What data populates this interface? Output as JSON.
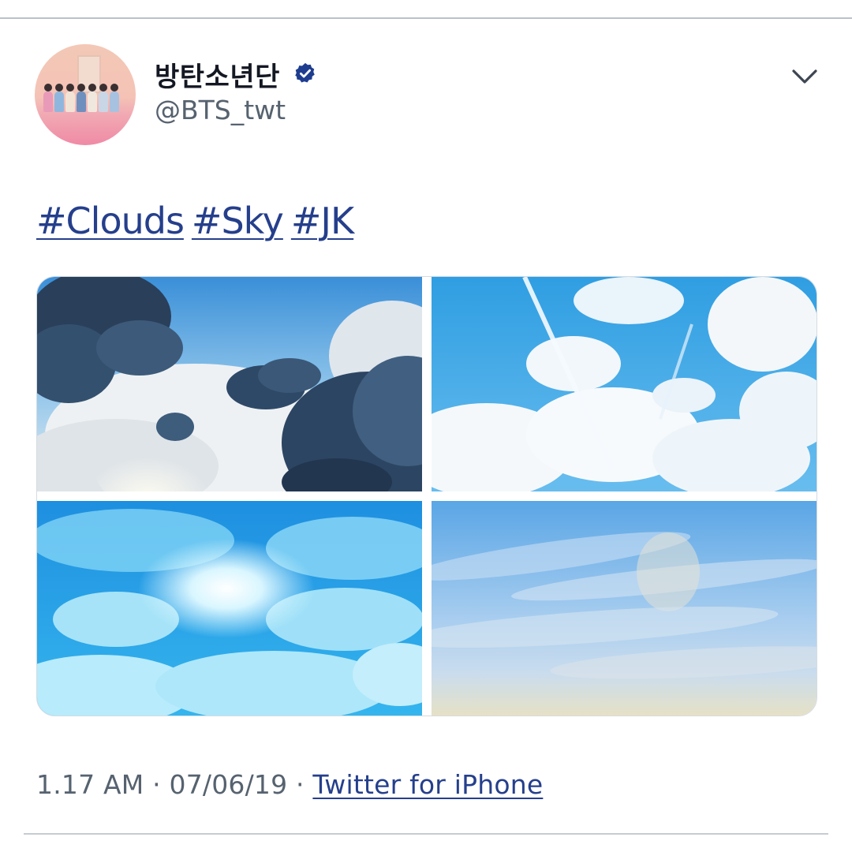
{
  "tweet": {
    "author": {
      "display_name": "방탄소년단",
      "handle": "@BTS_twt",
      "verified": true,
      "avatar_icon": "profile-avatar"
    },
    "menu_icon": "chevron-down-icon",
    "hashtags": [
      "#Clouds",
      "#Sky",
      "#JK"
    ],
    "media": [
      {
        "icon": "sky-photo-dark-clouds"
      },
      {
        "icon": "sky-photo-contrails"
      },
      {
        "icon": "sky-photo-bright-clouds"
      },
      {
        "icon": "sky-photo-pale-sky"
      }
    ],
    "meta": {
      "time": "1.17 AM",
      "separator": " · ",
      "date": "07/06/19",
      "source": "Twitter for iPhone"
    }
  },
  "colors": {
    "link": "#253f8c",
    "verified_badge": "#1e3d8f",
    "secondary_text": "#56626f",
    "divider": "#b9c2cc"
  }
}
